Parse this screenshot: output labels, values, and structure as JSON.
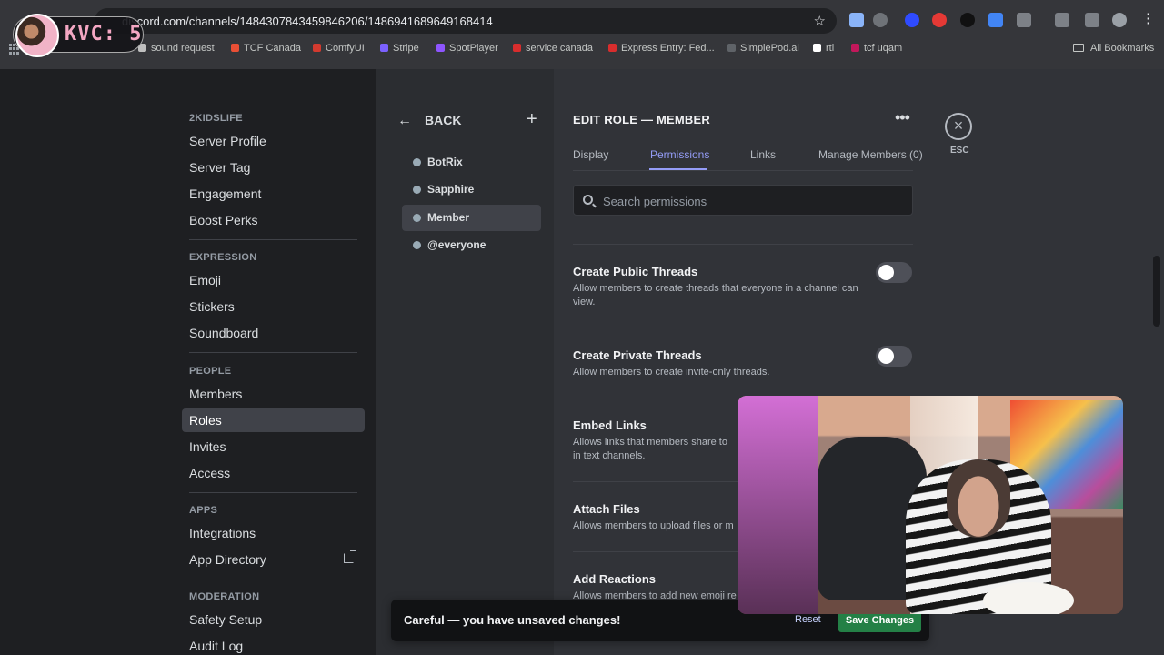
{
  "browser": {
    "url": "discord.com/channels/1484307843459846206/1486941689649168414",
    "bookmarks": [
      {
        "label": "sound request",
        "color": "#bfbfbf"
      },
      {
        "label": "TCF Canada",
        "color": "#e94f35"
      },
      {
        "label": "ComfyUI",
        "color": "#d23a2f"
      },
      {
        "label": "Stripe",
        "color": "#7b61ff"
      },
      {
        "label": "SpotPlayer",
        "color": "#8e55ff"
      },
      {
        "label": "service canada",
        "color": "#d82d2d"
      },
      {
        "label": "Express Entry: Fed...",
        "color": "#d82d2d"
      },
      {
        "label": "SimplePod.ai",
        "color": "#5f6368"
      },
      {
        "label": "rtl",
        "color": "#ffffff"
      },
      {
        "label": "tcf uqam",
        "color": "#c2185b"
      }
    ],
    "all_bookmarks": "All Bookmarks"
  },
  "overlay": {
    "kvc_label": "KVC: 5"
  },
  "sidebar": {
    "server_name": "2KIDSLIFE",
    "groups": [
      {
        "heading": "",
        "items": [
          "Server Profile",
          "Server Tag",
          "Engagement",
          "Boost Perks"
        ]
      },
      {
        "heading": "EXPRESSION",
        "items": [
          "Emoji",
          "Stickers",
          "Soundboard"
        ]
      },
      {
        "heading": "PEOPLE",
        "items": [
          "Members",
          "Roles",
          "Invites",
          "Access"
        ]
      },
      {
        "heading": "APPS",
        "items": [
          "Integrations",
          "App Directory"
        ]
      },
      {
        "heading": "MODERATION",
        "items": [
          "Safety Setup",
          "Audit Log"
        ]
      }
    ],
    "active_item": "Roles"
  },
  "roles": {
    "back_label": "BACK",
    "items": [
      "BotRix",
      "Sapphire",
      "Member",
      "@everyone"
    ],
    "active": "Member"
  },
  "editor": {
    "title": "EDIT ROLE — MEMBER",
    "tabs": [
      "Display",
      "Permissions",
      "Links",
      "Manage Members (0)"
    ],
    "active_tab": "Permissions",
    "search_placeholder": "Search permissions",
    "close_label": "ESC",
    "permissions": [
      {
        "title": "Create Public Threads",
        "description": "Allow members to create threads that everyone in a channel can view.",
        "enabled": false
      },
      {
        "title": "Create Private Threads",
        "description": "Allow members to create invite-only threads.",
        "enabled": false
      },
      {
        "title": "Embed Links",
        "description": "Allows links that members share to",
        "description_line2": "in text channels.",
        "enabled": false
      },
      {
        "title": "Attach Files",
        "description": "Allows members to upload files or m",
        "enabled": false
      },
      {
        "title": "Add Reactions",
        "description": "Allows members to add new emoji re",
        "enabled": false
      }
    ]
  },
  "unsaved_bar": {
    "message": "Careful — you have unsaved changes!",
    "reset": "Reset",
    "save": "Save Changes"
  }
}
